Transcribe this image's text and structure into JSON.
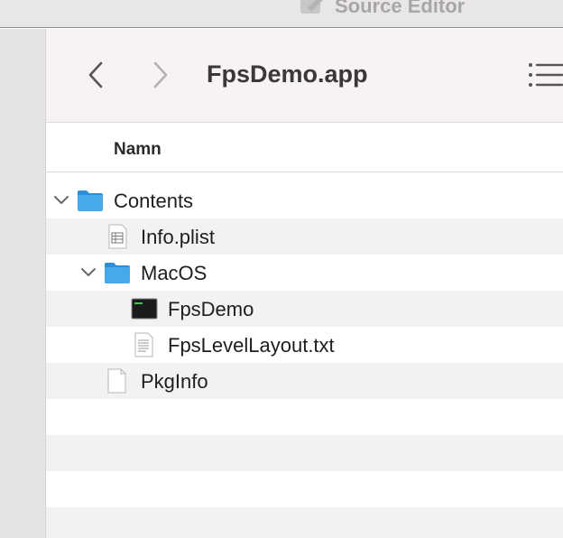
{
  "menubar": {
    "title": "Source Editor",
    "icon": "source-editor-app-icon"
  },
  "toolbar": {
    "title": "FpsDemo.app",
    "back_icon": "chevron-left-icon",
    "forward_icon": "chevron-right-icon",
    "view_icon": "list-view-icon"
  },
  "columns": {
    "name": "Namn"
  },
  "files": [
    {
      "name": "Contents",
      "icon": "folder-icon",
      "expanded": true
    },
    {
      "name": "Info.plist",
      "icon": "plist-document-icon"
    },
    {
      "name": "MacOS",
      "icon": "folder-icon",
      "expanded": true
    },
    {
      "name": "FpsDemo",
      "icon": "terminal-executable-icon"
    },
    {
      "name": "FpsLevelLayout.txt",
      "icon": "text-document-icon"
    },
    {
      "name": "PkgInfo",
      "icon": "blank-document-icon"
    }
  ],
  "colors": {
    "toolbar_bg": "#f8f2f2",
    "folder_blue": "#3ba4e6",
    "alt_row": "#f3f2f2"
  }
}
